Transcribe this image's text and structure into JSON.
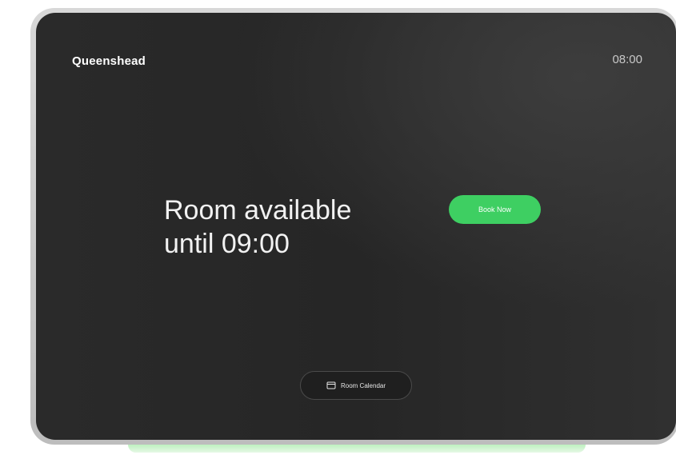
{
  "header": {
    "room_name": "Queenshead",
    "time": "08:00"
  },
  "main": {
    "status_line1": "Room available",
    "status_line2": "until 09:00",
    "book_button_label": "Book Now"
  },
  "footer": {
    "calendar_button_label": "Room Calendar",
    "calendar_icon": "calendar-icon"
  },
  "colors": {
    "accent_green": "#3ecf62",
    "screen_background": "#2a2a2a"
  }
}
